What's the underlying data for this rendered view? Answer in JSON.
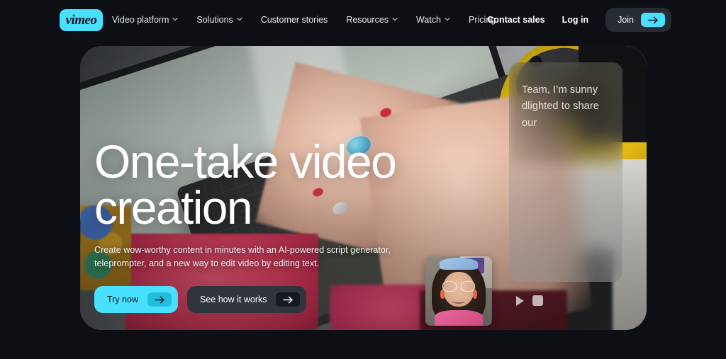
{
  "brand": {
    "logo_text": "vimeo",
    "accent": "#49e0ff",
    "page_bg": "#0d0f14"
  },
  "nav": {
    "items": [
      {
        "label": "Video platform",
        "has_caret": true,
        "icon": "chevron-down-icon"
      },
      {
        "label": "Solutions",
        "has_caret": true,
        "icon": "chevron-down-icon"
      },
      {
        "label": "Customer stories",
        "has_caret": false,
        "icon": ""
      },
      {
        "label": "Resources",
        "has_caret": true,
        "icon": "chevron-down-icon"
      },
      {
        "label": "Watch",
        "has_caret": true,
        "icon": "chevron-down-icon"
      },
      {
        "label": "Pricing",
        "has_caret": false,
        "icon": ""
      }
    ],
    "contact_sales": "Contact sales",
    "log_in": "Log in",
    "join": "Join",
    "join_icon": "arrow-right-icon"
  },
  "hero": {
    "headline_line1": "One-take video",
    "headline_line2": "creation",
    "subhead": "Create wow-worthy content in minutes with an AI-powered script generator, teleprompter, and a new way to edit video by editing text.",
    "cta_primary": {
      "label": "Try now",
      "icon": "arrow-right-icon"
    },
    "cta_secondary": {
      "label": "See how it works",
      "icon": "arrow-right-icon"
    },
    "teleprompter_text": "Team, I’m sunny dlighted to share our",
    "controls": [
      {
        "name": "play",
        "icon": "play-icon"
      },
      {
        "name": "stop",
        "icon": "stop-icon"
      }
    ]
  }
}
